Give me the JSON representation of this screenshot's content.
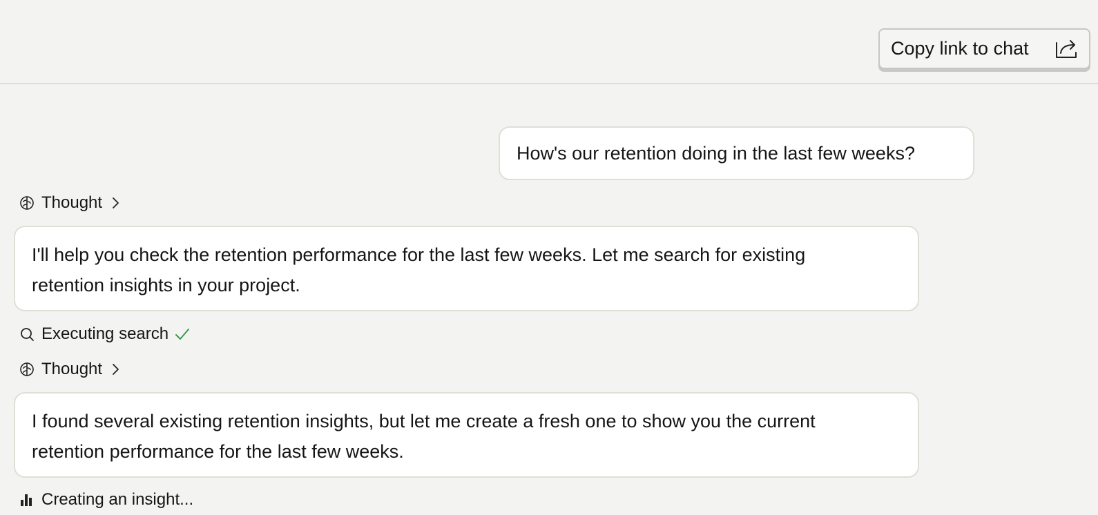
{
  "header": {
    "copy_link_label": "Copy link to chat",
    "copy_link_icon": "share-icon"
  },
  "conversation": {
    "user_message": "How's our retention doing in the last few weeks?",
    "steps": [
      {
        "type": "thought",
        "label": "Thought",
        "icon": "brain-icon"
      },
      {
        "type": "message",
        "lines": [
          "I'll help you check the retention performance for the last few weeks. Let me search for existing",
          "retention insights in your project."
        ]
      },
      {
        "type": "tool",
        "label": "Executing search",
        "icon": "search-icon",
        "status": "done"
      },
      {
        "type": "thought",
        "label": "Thought",
        "icon": "brain-icon"
      },
      {
        "type": "message",
        "lines": [
          "I found several existing retention insights, but let me create a fresh one to show you the current",
          "retention performance for the last few weeks."
        ]
      },
      {
        "type": "tool",
        "label": "Creating an insight...",
        "icon": "bar-chart-icon",
        "status": "in-progress"
      }
    ]
  },
  "colors": {
    "background": "#f3f3f1",
    "bubble": "#ffffff",
    "border": "#dfdfd8",
    "success": "#3a9a4a"
  }
}
